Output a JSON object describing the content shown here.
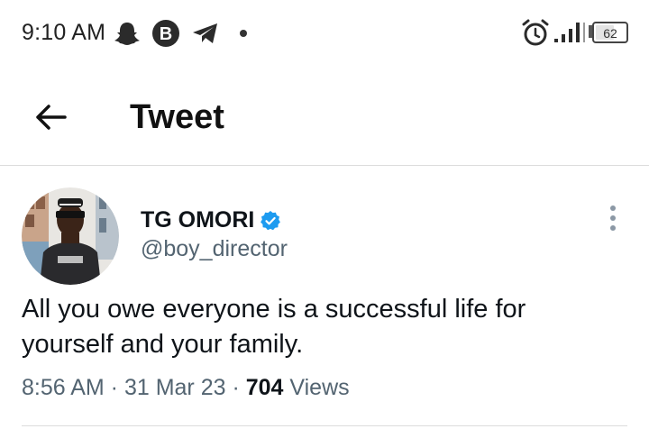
{
  "status_bar": {
    "time": "9:10 AM",
    "icons": [
      "snapchat-icon",
      "b-circle-icon",
      "telegram-icon",
      "alarm-icon",
      "signal-icon"
    ],
    "battery": "62"
  },
  "header": {
    "title": "Tweet",
    "back_icon": "arrow-left-icon"
  },
  "tweet": {
    "display_name": "TG OMORI",
    "handle": "@boy_director",
    "verified_color": "#1d9bf0",
    "text": "All you owe everyone is a successful life for yourself and your family.",
    "time": "8:56 AM",
    "sep1": " · ",
    "date": "31 Mar 23",
    "sep2": " · ",
    "views_count": "704",
    "views_label": " Views"
  },
  "colors": {
    "text_primary": "#0f1419",
    "text_secondary": "#536471",
    "divider": "#dcdcdc"
  }
}
